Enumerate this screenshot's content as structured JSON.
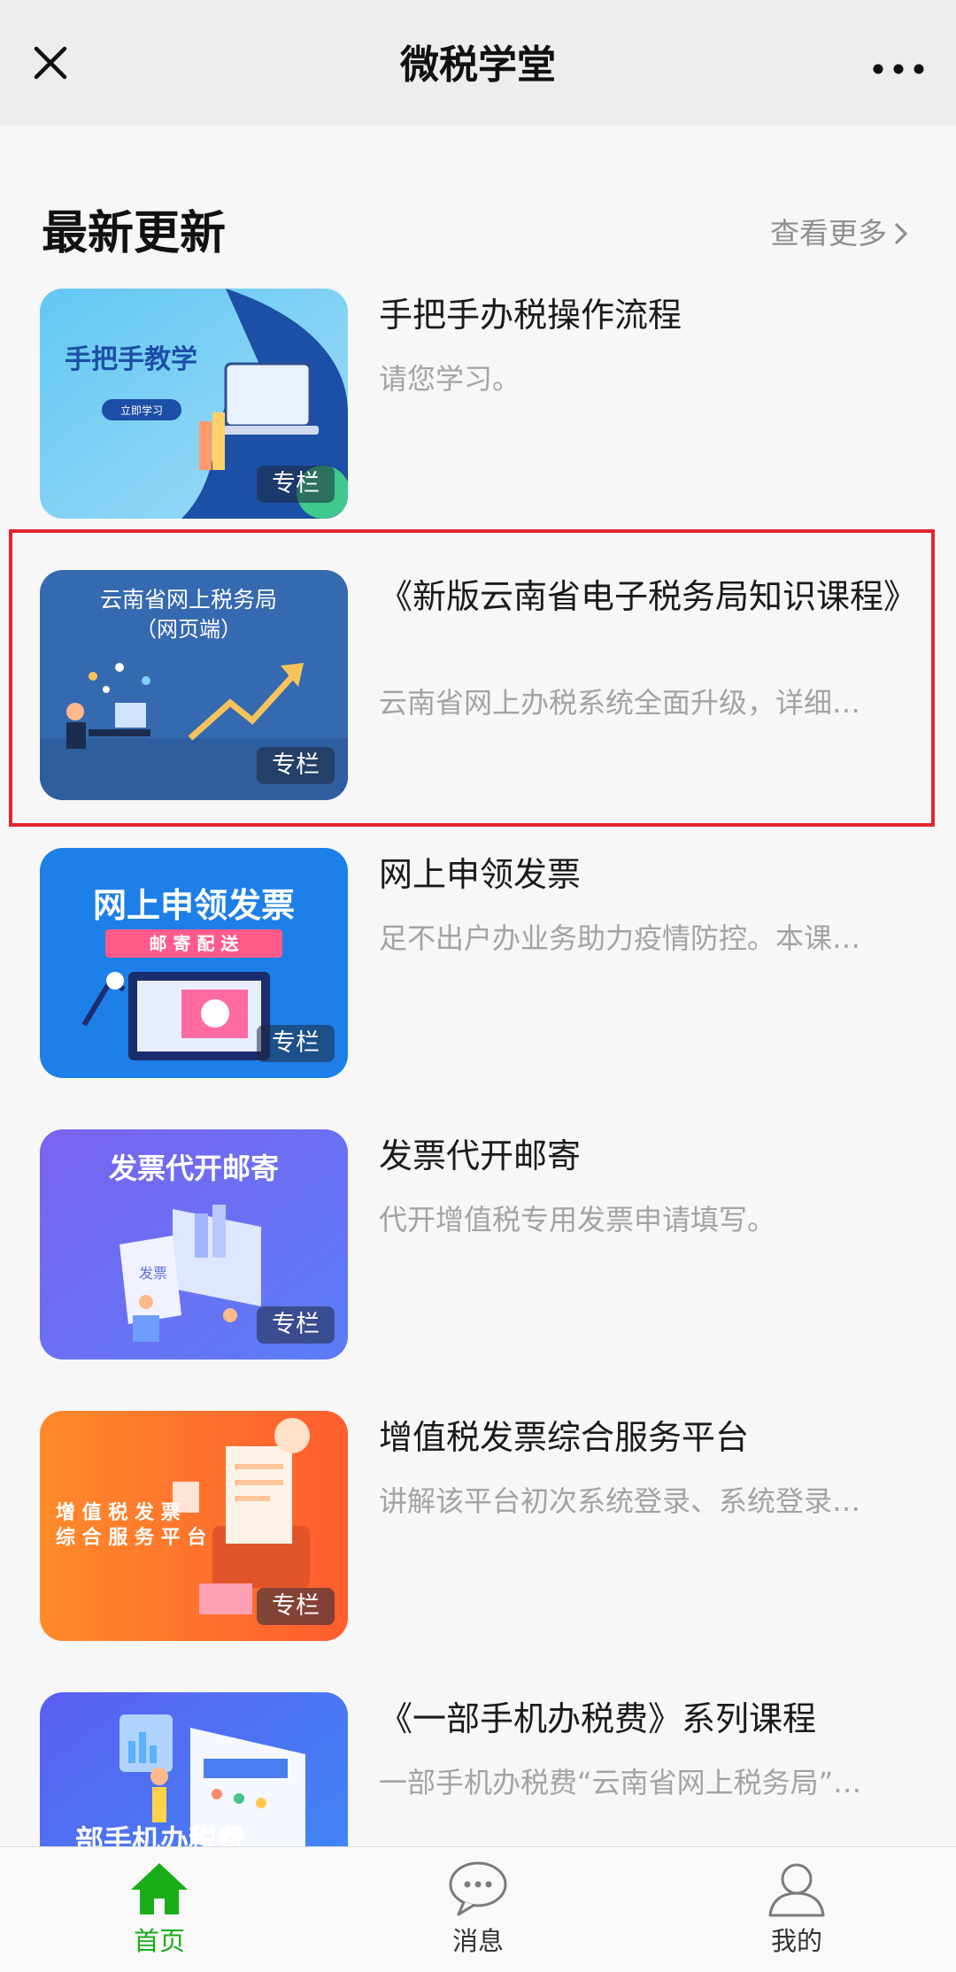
{
  "nav": {
    "title": "微税学堂",
    "close_icon": "close-icon",
    "more_icon": "more-icon"
  },
  "section": {
    "title": "最新更新",
    "see_more": "查看更多"
  },
  "items": [
    {
      "title": "手把手办税操作流程",
      "desc": "请您学习。",
      "badge": "专栏",
      "thumb_text": "手把手教学",
      "thumb_sub": "立即学习"
    },
    {
      "title": "《新版云南省电子税务局知识课程》",
      "desc": "云南省网上办税系统全面升级，详细…",
      "badge": "专栏",
      "thumb_text": "云南省网上税务局",
      "thumb_sub": "（网页端）",
      "highlighted": true
    },
    {
      "title": "网上申领发票",
      "desc": "足不出户办业务助力疫情防控。本课…",
      "badge": "专栏",
      "thumb_text": "网上申领发票",
      "thumb_sub": "邮 寄 配 送"
    },
    {
      "title": "发票代开邮寄",
      "desc": "代开增值税专用发票申请填写。",
      "badge": "专栏",
      "thumb_text": "发票代开邮寄",
      "thumb_sub": "发票"
    },
    {
      "title": "增值税发票综合服务平台",
      "desc": "讲解该平台初次系统登录、系统登录…",
      "badge": "专栏",
      "thumb_text": "增 值 税 发 票",
      "thumb_sub": "综 合 服 务 平 台"
    },
    {
      "title": "《一部手机办税费》系列课程",
      "desc": "一部手机办税费“云南省网上税务局”…",
      "thumb_text": "部手机办税费"
    }
  ],
  "tabbar": {
    "tabs": [
      {
        "label": "首页",
        "icon": "home-icon",
        "active": true
      },
      {
        "label": "消息",
        "icon": "message-icon",
        "active": false
      },
      {
        "label": "我的",
        "icon": "user-icon",
        "active": false
      }
    ]
  },
  "colors": {
    "active_tab": "#1aad19",
    "highlight_border": "#e3252f"
  }
}
